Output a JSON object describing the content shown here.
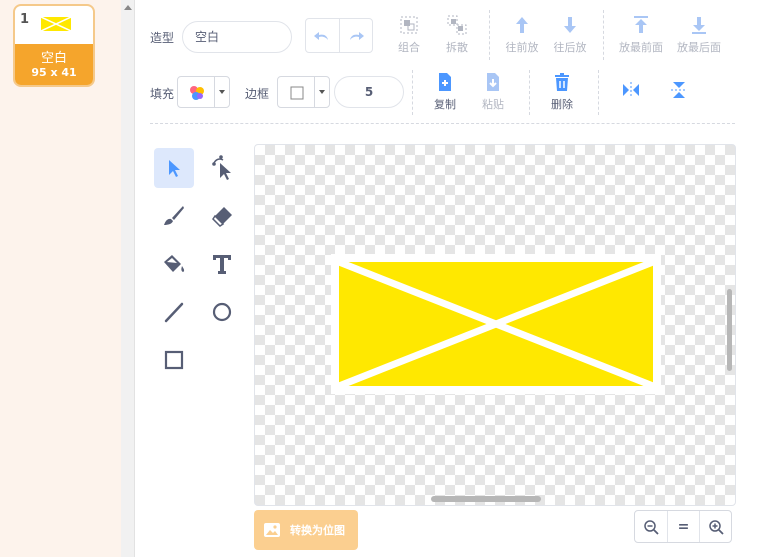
{
  "costume_list": {
    "items": [
      {
        "number": "1",
        "name": "空白",
        "size": "95 x 41",
        "thumb_color": "#ffe800"
      }
    ]
  },
  "toolbar": {
    "costume_label": "造型",
    "costume_name": "空白",
    "group_label": "组合",
    "ungroup_label": "拆散",
    "forward_label": "往前放",
    "backward_label": "往后放",
    "front_label": "放最前面",
    "back_label": "放最后面",
    "fill_label": "填充",
    "outline_label": "边框",
    "outline_width": "5",
    "copy_label": "复制",
    "paste_label": "粘贴",
    "delete_label": "删除"
  },
  "tools": [
    "select",
    "reshape",
    "brush",
    "eraser",
    "fill",
    "text",
    "line",
    "circle",
    "rectangle"
  ],
  "selected_tool": "select",
  "colors": {
    "accent": "#4c97ff",
    "shape_fill": "#ffe800",
    "costume_orange": "#f5a52c",
    "disabled": "#b2b6c1"
  },
  "bitmap_button": "转换为位图",
  "zoom": {
    "out": "zoom-out",
    "reset": "=",
    "in": "zoom-in"
  }
}
